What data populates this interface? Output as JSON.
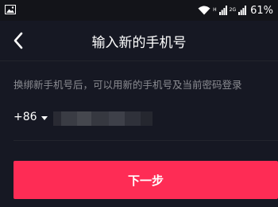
{
  "status_bar": {
    "gallery_icon": "image-icon",
    "wifi_icon": "wifi-icon",
    "network_label_top": "H",
    "network_label_bottom": "",
    "network_label_top2": "2G",
    "network_label_bottom2": "",
    "signal_icon": "signal-icon",
    "battery_text": "61%"
  },
  "header": {
    "back_icon": "chevron-left-icon",
    "title": "输入新的手机号"
  },
  "main": {
    "hint": "换绑新手机号后，可以用新的手机号及当前密码登录",
    "country_code": "+86",
    "phone_value_redacted": true
  },
  "actions": {
    "next_label": "下一步"
  },
  "colors": {
    "background": "#161823",
    "status_bar": "#131419",
    "accent": "#fe2c55",
    "hint_text": "#8a8b91",
    "divider": "#22242d"
  }
}
